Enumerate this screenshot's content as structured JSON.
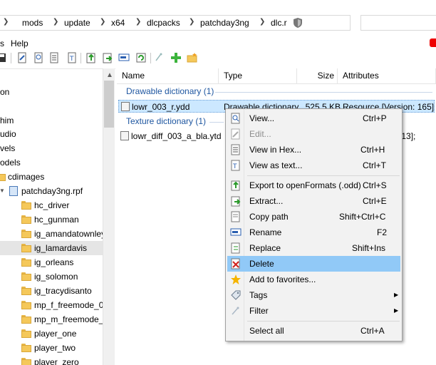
{
  "address": {
    "crumbs": [
      "mods",
      "update",
      "x64",
      "dlcpacks",
      "patchday3ng",
      "dlc.r"
    ]
  },
  "menubar": {
    "items": [
      "s",
      "Help"
    ]
  },
  "tree": {
    "items": [
      {
        "label": "on"
      },
      {
        "label": "him"
      },
      {
        "label": "udio"
      },
      {
        "label": "vels"
      },
      {
        "label": "odels"
      },
      {
        "label": "cdimages"
      },
      {
        "label": "patchday3ng.rpf"
      },
      {
        "label": "hc_driver"
      },
      {
        "label": "hc_gunman"
      },
      {
        "label": "ig_amandatownley"
      },
      {
        "label": "ig_lamardavis"
      },
      {
        "label": "ig_orleans"
      },
      {
        "label": "ig_solomon"
      },
      {
        "label": "ig_tracydisanto"
      },
      {
        "label": "mp_f_freemode_01"
      },
      {
        "label": "mp_m_freemode_01"
      },
      {
        "label": "player_one"
      },
      {
        "label": "player_two"
      },
      {
        "label": "player_zero"
      }
    ]
  },
  "list": {
    "columns": {
      "name": "Name",
      "type": "Type",
      "size": "Size",
      "attributes": "Attributes"
    },
    "groups": [
      {
        "title": "Drawable dictionary (1)",
        "rows": [
          {
            "name": "lowr_003_r.ydd",
            "type": "Drawable dictionary",
            "size": "525.5 KB",
            "attributes": "Resource [Version: 165];"
          }
        ]
      },
      {
        "title": "Texture dictionary (1)",
        "rows": [
          {
            "name": "lowr_diff_003_a_bla.ytd",
            "type": "",
            "size": "",
            "attributes": "n: 13];"
          }
        ]
      }
    ]
  },
  "context_menu": {
    "items": [
      {
        "label": "View...",
        "shortcut": "Ctrl+P",
        "icon": "view-icon",
        "disabled": false
      },
      {
        "label": "Edit...",
        "shortcut": "",
        "icon": "edit-icon",
        "disabled": true
      },
      {
        "label": "View in Hex...",
        "shortcut": "Ctrl+H",
        "icon": "hex-icon",
        "disabled": false
      },
      {
        "label": "View as text...",
        "shortcut": "Ctrl+T",
        "icon": "text-icon",
        "disabled": false
      },
      {
        "label": "Export to openFormats (.odd)",
        "shortcut": "Ctrl+S",
        "icon": "export-icon",
        "disabled": false
      },
      {
        "label": "Extract...",
        "shortcut": "Ctrl+E",
        "icon": "extract-icon",
        "disabled": false
      },
      {
        "label": "Copy path",
        "shortcut": "Shift+Ctrl+C",
        "icon": "copy-icon",
        "disabled": false
      },
      {
        "label": "Rename",
        "shortcut": "F2",
        "icon": "rename-icon",
        "disabled": false
      },
      {
        "label": "Replace",
        "shortcut": "Shift+Ins",
        "icon": "replace-icon",
        "disabled": false
      },
      {
        "label": "Delete",
        "shortcut": "",
        "icon": "delete-icon",
        "disabled": false
      },
      {
        "label": "Add to favorites...",
        "shortcut": "",
        "icon": "star-icon",
        "disabled": false
      },
      {
        "label": "Tags",
        "shortcut": "",
        "icon": "tag-icon",
        "disabled": false
      },
      {
        "label": "Filter",
        "shortcut": "",
        "icon": "filter-icon",
        "disabled": false
      },
      {
        "label": "Select all",
        "shortcut": "Ctrl+A",
        "icon": "",
        "disabled": false
      }
    ]
  },
  "colors": {
    "highlight": "#91c9f7",
    "selection": "#cce8ff",
    "group_title": "#1e56a0",
    "folder": "#f5c85a"
  }
}
